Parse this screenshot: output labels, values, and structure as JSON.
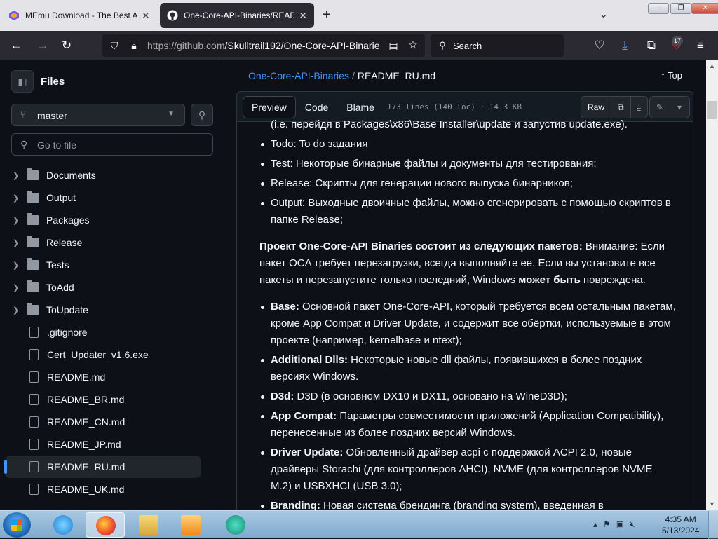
{
  "browser": {
    "tabs": [
      {
        "title": "MEmu Download - The Best An",
        "active": false
      },
      {
        "title": "One-Core-API-Binaries/READM",
        "active": true
      }
    ],
    "url_base": "https://github.com",
    "url_path": "/Skulltrail192/One-Core-API-Binarie",
    "search_placeholder": "Search",
    "badge_count": "17"
  },
  "sidebar": {
    "title": "Files",
    "branch": "master",
    "goto_placeholder": "Go to file",
    "items": [
      {
        "name": "Documents",
        "type": "folder"
      },
      {
        "name": "Output",
        "type": "folder"
      },
      {
        "name": "Packages",
        "type": "folder"
      },
      {
        "name": "Release",
        "type": "folder"
      },
      {
        "name": "Tests",
        "type": "folder"
      },
      {
        "name": "ToAdd",
        "type": "folder"
      },
      {
        "name": "ToUpdate",
        "type": "folder"
      },
      {
        "name": ".gitignore",
        "type": "file"
      },
      {
        "name": "Cert_Updater_v1.6.exe",
        "type": "file"
      },
      {
        "name": "README.md",
        "type": "file"
      },
      {
        "name": "README_BR.md",
        "type": "file"
      },
      {
        "name": "README_CN.md",
        "type": "file"
      },
      {
        "name": "README_JP.md",
        "type": "file"
      },
      {
        "name": "README_RU.md",
        "type": "file",
        "selected": true
      },
      {
        "name": "README_UK.md",
        "type": "file"
      }
    ]
  },
  "main": {
    "breadcrumb_repo": "One-Core-API-Binaries",
    "breadcrumb_sep": "/",
    "breadcrumb_file": "README_RU.md",
    "top_label": "Top",
    "tabs": [
      "Preview",
      "Code",
      "Blame"
    ],
    "file_info": "173 lines (140 loc) · 14.3 KB",
    "raw_label": "Raw",
    "article": {
      "cut_top": "(i.e. перейдя в Packages\\x86\\Base Installer\\update и запустив update.exe).",
      "list1": [
        "Todo: To do задания",
        "Test: Некоторые бинарные файлы и документы для тестирования;",
        "Release: Скрипты для генерации нового выпуска бинарников;",
        "Output: Выходные двоичные файлы, можно сгенерировать с помощью скриптов в папке Release;"
      ],
      "para_bold": "Проект One-Core-API Binaries состоит из следующих пакетов:",
      "para_text1": " Внимание: Если пакет OCA требует перезагрузки, всегда выполняйте ее. Если вы установите все пакеты и перезапустите только последний, Windows ",
      "para_bold2": "может быть",
      "para_text2": " повреждена.",
      "list2": [
        {
          "b": "Base:",
          "t": " Основной пакет One-Core-API, который требуется всем остальным пакетам, кроме App Compat и Driver Update, и содержит все обёртки, используемые в этом проекте (например, kernelbase и ntext);"
        },
        {
          "b": "Additional Dlls:",
          "t": " Некоторые новые dll файлы, появившихся в более поздних версиях Windows."
        },
        {
          "b": "D3d:",
          "t": " D3D (в основном DX10 и DX11, основано на WineD3D);"
        },
        {
          "b": "App Compat:",
          "t": " Параметры совместимости приложений (Application Compatibility), перенесенные из более поздних версий Windows."
        },
        {
          "b": "Driver Update:",
          "t": " Обновленный драйвер acpi с поддержкой ACPI 2.0, новые драйверы Storachi (для контроллеров AHCI), NVME (для контроллеров NVME M.2) и USBXHCI (USB 3.0);"
        },
        {
          "b": "Branding:",
          "t": " Новая система брендинга (branding system), введенная в"
        }
      ]
    }
  },
  "taskbar": {
    "time": "4:35 AM",
    "date": "5/13/2024"
  },
  "colors": {
    "bg": "#0d1117",
    "link": "#4493f8",
    "text": "#f0f6fc",
    "muted": "#9198a1"
  }
}
